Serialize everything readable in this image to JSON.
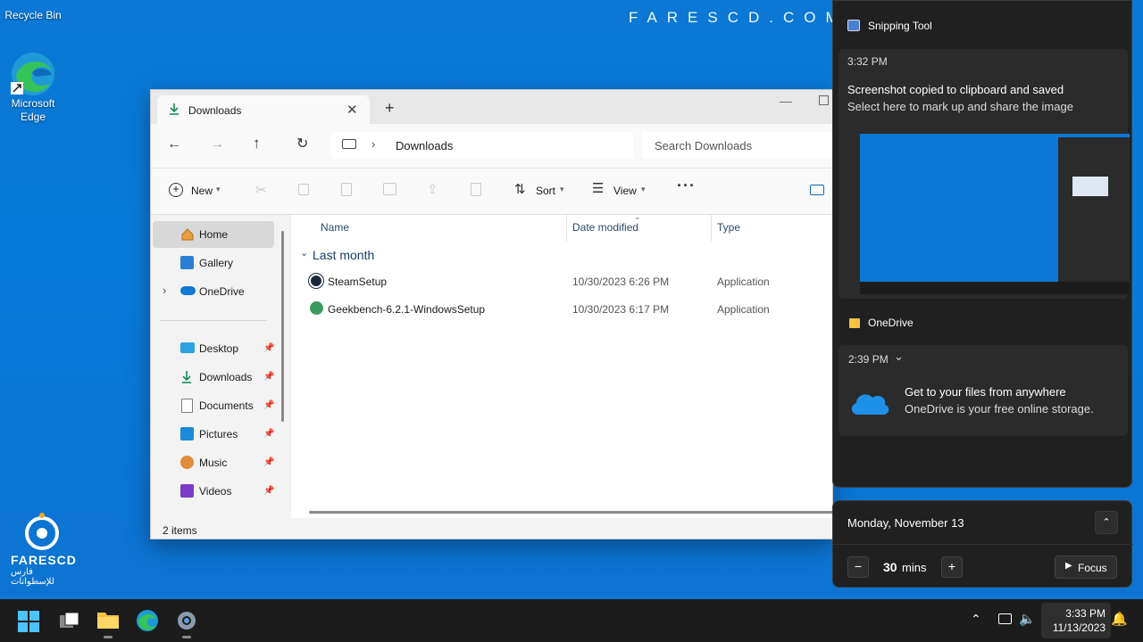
{
  "desktop": {
    "recycle_bin": "Recycle Bin",
    "edge_label": "Microsoft Edge",
    "watermark": "FARESCD.COM",
    "logo_name": "FARESCD",
    "logo_subtitle": "فارس للإسطوانات",
    "wallpaper_color": "#0a78d4"
  },
  "explorer": {
    "tab_title": "Downloads",
    "breadcrumb": "Downloads",
    "search_placeholder": "Search Downloads",
    "toolbar": {
      "new_label": "New",
      "sort_label": "Sort",
      "view_label": "View"
    },
    "nav": [
      {
        "label": "Home",
        "icon": "home-icon"
      },
      {
        "label": "Gallery",
        "icon": "gallery-icon"
      },
      {
        "label": "OneDrive",
        "icon": "cloud-icon"
      },
      {
        "label": "Desktop",
        "icon": "desktop-icon"
      },
      {
        "label": "Downloads",
        "icon": "download-icon"
      },
      {
        "label": "Documents",
        "icon": "document-icon"
      },
      {
        "label": "Pictures",
        "icon": "pictures-icon"
      },
      {
        "label": "Music",
        "icon": "music-icon"
      },
      {
        "label": "Videos",
        "icon": "video-icon"
      }
    ],
    "columns": [
      "Name",
      "Date modified",
      "Type"
    ],
    "group_label": "Last month",
    "files": [
      {
        "name": "SteamSetup",
        "date": "10/30/2023 6:26 PM",
        "type": "Application",
        "icon": "steam-icon"
      },
      {
        "name": "Geekbench-6.2.1-WindowsSetup",
        "date": "10/30/2023 6:17 PM",
        "type": "Application",
        "icon": "geekbench-icon"
      }
    ],
    "status": "2 items"
  },
  "notifications": {
    "snipping": {
      "app": "Snipping Tool",
      "time": "3:32 PM",
      "title": "Screenshot copied to clipboard and saved",
      "body": "Select here to mark up and share the image"
    },
    "onedrive": {
      "app": "OneDrive",
      "time": "2:39 PM",
      "title": "Get to your files from anywhere",
      "body": "OneDrive is your free online storage."
    }
  },
  "calendar": {
    "date": "Monday, November 13",
    "focus_minutes": "30",
    "focus_unit": "mins",
    "focus_button": "Focus"
  },
  "taskbar": {
    "time": "3:33 PM",
    "date": "11/13/2023"
  }
}
